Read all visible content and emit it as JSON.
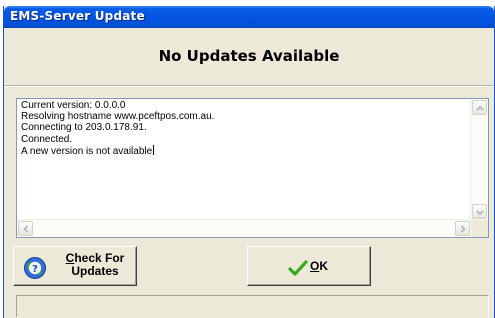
{
  "window": {
    "title": "EMS-Server Update"
  },
  "heading": "No Updates Available",
  "log": {
    "lines": [
      "Current version: 0.0.0.0",
      "Resolving hostname www.pceftpos.com.au.",
      "Connecting to 203.0.178.91.",
      "Connected.",
      "A new version is not available"
    ]
  },
  "buttons": {
    "check_updates": {
      "accel": "C",
      "line1_rest": "heck For",
      "line2": "Updates",
      "icon": "globe-help-icon"
    },
    "ok": {
      "accel": "O",
      "rest": "K",
      "icon": "checkmark-icon"
    }
  },
  "colors": {
    "titlebar": "#0554e2",
    "dialog_bg": "#ece9d8",
    "check_green": "#39a821",
    "globe_blue": "#2f6fd8"
  }
}
